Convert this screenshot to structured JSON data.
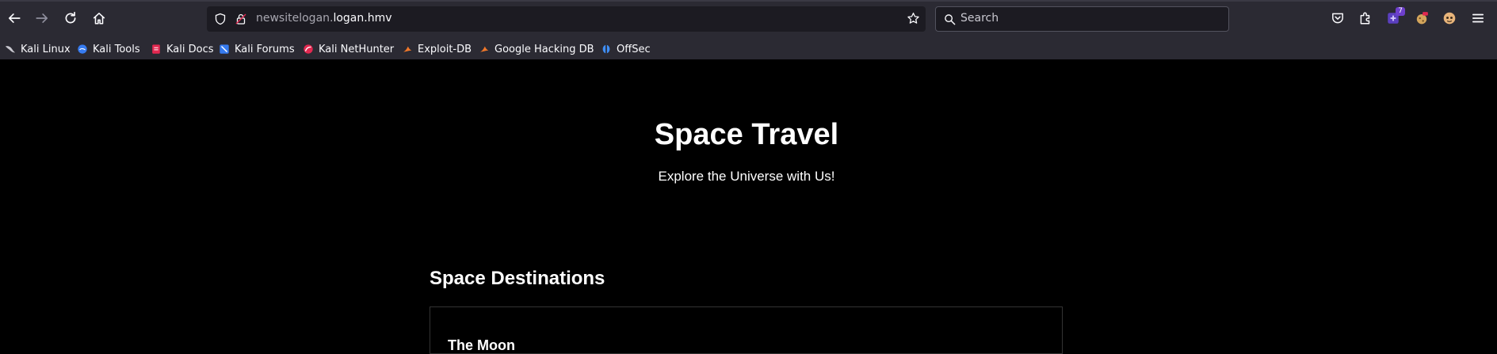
{
  "browser": {
    "url": {
      "subdomain": "newsitelogan.",
      "domain": "logan.hmv"
    },
    "search_placeholder": "Search",
    "extension_badge": "7"
  },
  "bookmarks": [
    {
      "label": "Kali Linux",
      "icon": "kali-dragon-icon"
    },
    {
      "label": "Kali Tools",
      "icon": "kali-tools-icon"
    },
    {
      "label": "Kali Docs",
      "icon": "kali-docs-icon"
    },
    {
      "label": "Kali Forums",
      "icon": "kali-forums-icon"
    },
    {
      "label": "Kali NetHunter",
      "icon": "nethunter-icon"
    },
    {
      "label": "Exploit-DB",
      "icon": "exploit-db-icon"
    },
    {
      "label": "Google Hacking DB",
      "icon": "ghdb-icon"
    },
    {
      "label": "OffSec",
      "icon": "offsec-icon"
    }
  ],
  "page": {
    "title": "Space Travel",
    "subtitle": "Explore the Universe with Us!",
    "section_title": "Space Destinations",
    "first_card_title": "The Moon"
  },
  "colors": {
    "chrome_bg": "#2b2a33",
    "field_bg": "#1c1b22",
    "page_bg": "#000000",
    "text": "#ffffff"
  }
}
